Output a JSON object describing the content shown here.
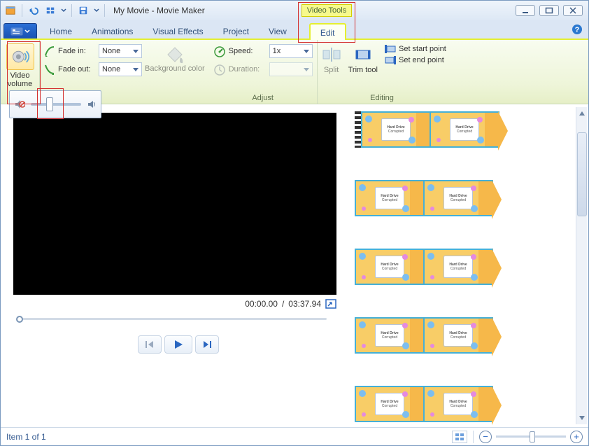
{
  "window": {
    "title": "My Movie - Movie Maker"
  },
  "contextual_tab_label": "Video Tools",
  "tabs": {
    "home": "Home",
    "animations": "Animations",
    "vfx": "Visual Effects",
    "project": "Project",
    "view": "View",
    "edit": "Edit"
  },
  "ribbon": {
    "video_volume_caption": "Video volume",
    "fade_in_label": "Fade in:",
    "fade_out_label": "Fade out:",
    "fade_in_value": "None",
    "fade_out_value": "None",
    "bg_color_caption": "Background color",
    "speed_label": "Speed:",
    "speed_value": "1x",
    "duration_label": "Duration:",
    "duration_value": "",
    "adjust_group": "Adjust",
    "split_caption": "Split",
    "trim_caption": "Trim tool",
    "set_start": "Set start point",
    "set_end": "Set end point",
    "editing_group": "Editing"
  },
  "preview": {
    "time_current": "00:00.00",
    "time_total": "03:37.94"
  },
  "storyboard": {
    "clip_title": "Hard Drive",
    "clip_sub": "Corrupted",
    "rows": 5
  },
  "status": {
    "text": "Item 1 of 1"
  }
}
